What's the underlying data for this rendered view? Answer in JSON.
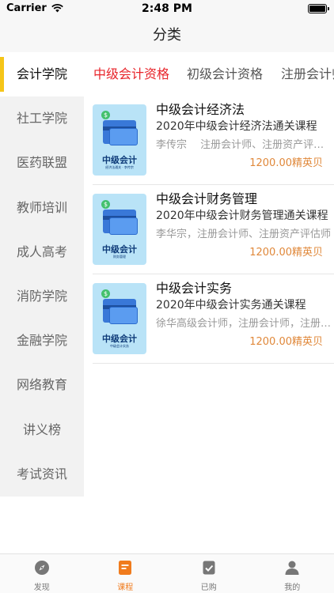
{
  "status_bar": {
    "carrier": "Carrier",
    "time": "2:48 PM"
  },
  "nav": {
    "title": "分类"
  },
  "sidebar": {
    "items": [
      {
        "label": "会计学院",
        "active": true
      },
      {
        "label": "社工学院",
        "active": false
      },
      {
        "label": "医药联盟",
        "active": false
      },
      {
        "label": "教师培训",
        "active": false
      },
      {
        "label": "成人高考",
        "active": false
      },
      {
        "label": "消防学院",
        "active": false
      },
      {
        "label": "金融学院",
        "active": false
      },
      {
        "label": "网络教育",
        "active": false
      },
      {
        "label": "讲义榜",
        "active": false
      },
      {
        "label": "考试资讯",
        "active": false
      }
    ]
  },
  "tabs": [
    {
      "label": "中级会计资格",
      "active": true
    },
    {
      "label": "初级会计资格",
      "active": false
    },
    {
      "label": "注册会计师",
      "active": false
    }
  ],
  "courses": [
    {
      "title": "中级会计经济法",
      "subtitle": "2020年中级会计经济法通关课程",
      "teachers": "李传宗　 注册会计师、注册资产评估师",
      "price": "1200.00精英贝",
      "thumb_label": "中级会计",
      "thumb_sub": "经济法通关 · 李传宗"
    },
    {
      "title": "中级会计财务管理",
      "subtitle": "2020年中级会计财务管理通关课程",
      "teachers": "李华宗，注册会计师、注册资产评估师",
      "price": "1200.00精英贝",
      "thumb_label": "中级会计",
      "thumb_sub": "财务管理"
    },
    {
      "title": "中级会计实务",
      "subtitle": "2020年中级会计实务通关课程",
      "teachers": "徐华高级会计师，注册会计师，注册资产评估师",
      "price": "1200.00精英贝",
      "thumb_label": "中级会计",
      "thumb_sub": "中级会计实务"
    }
  ],
  "tabbar": {
    "items": [
      {
        "label": "发现",
        "icon": "compass-icon",
        "active": false
      },
      {
        "label": "课程",
        "icon": "course-book-icon",
        "active": true
      },
      {
        "label": "已购",
        "icon": "purchased-check-icon",
        "active": false
      },
      {
        "label": "我的",
        "icon": "person-icon",
        "active": false
      }
    ]
  },
  "colors": {
    "accent_red": "#e8252b",
    "sidebar_indicator": "#f5c518",
    "price_orange": "#e0883a",
    "tabbar_active": "#f07b1d"
  }
}
